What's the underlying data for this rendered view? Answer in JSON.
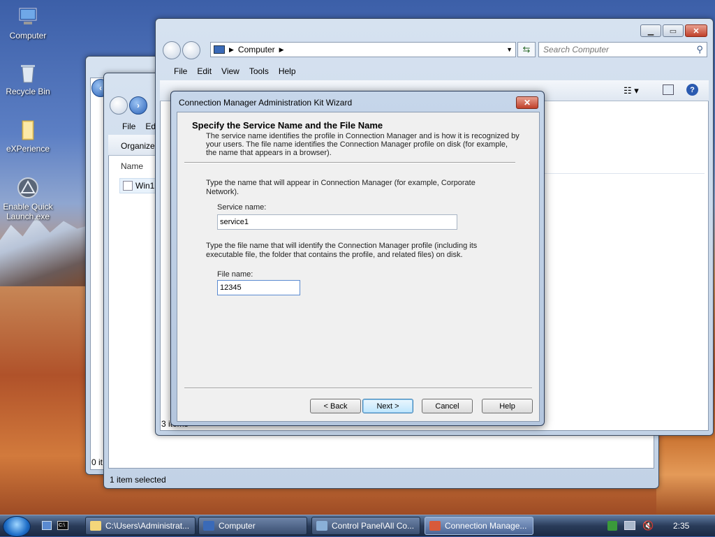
{
  "desktop": {
    "icons": [
      {
        "label": "Computer"
      },
      {
        "label": "Recycle Bin"
      },
      {
        "label": "eXPerience"
      },
      {
        "label": "Enable Quick Launch.exe"
      }
    ]
  },
  "window_back2": {
    "status": "0 it"
  },
  "window_back1": {
    "menu": {
      "file": "File",
      "edit": "Ed"
    },
    "organize": "Organize",
    "column_name": "Name",
    "file_item": "Win1(",
    "status": "1 item selected"
  },
  "explorer": {
    "address": "Computer",
    "search_placeholder": "Search Computer",
    "menu": {
      "file": "File",
      "edit": "Edit",
      "view": "View",
      "tools": "Tools",
      "help": "Help"
    },
    "status": "3 items"
  },
  "dialog": {
    "title": "Connection Manager Administration Kit Wizard",
    "close": "✕",
    "header_title": "Specify the Service Name and the File Name",
    "header_desc": "The service name identifies the profile in Connection Manager and is how it is recognized by your users. The file name identifies the Connection Manager profile on disk (for example, the name that appears in a browser).",
    "service_instructions": "Type the name that will appear in Connection Manager (for example, Corporate Network).",
    "service_label": "Service name:",
    "service_value": "service1",
    "file_instructions": "Type the file name that will identify the Connection Manager profile (including its executable file, the folder that contains the profile, and related files) on disk.",
    "file_label": "File name:",
    "file_value": "12345",
    "buttons": {
      "back": "< Back",
      "next": "Next >",
      "cancel": "Cancel",
      "help": "Help"
    }
  },
  "taskbar": {
    "items": [
      {
        "label": "C:\\Users\\Administrat..."
      },
      {
        "label": "Computer"
      },
      {
        "label": "Control Panel\\All Co..."
      },
      {
        "label": "Connection Manage..."
      }
    ],
    "clock": "2:35"
  }
}
